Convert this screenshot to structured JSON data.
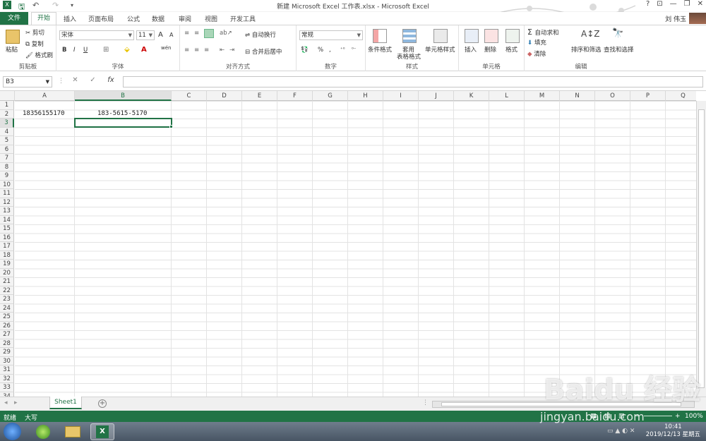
{
  "window": {
    "title": "新建 Microsoft Excel 工作表.xlsx - Microsoft Excel",
    "controls": [
      "?",
      "⊡",
      "—",
      "❐",
      "✕"
    ],
    "user_name": "刘 伟玉"
  },
  "tabs": [
    "文件",
    "开始",
    "插入",
    "页面布局",
    "公式",
    "数据",
    "审阅",
    "视图",
    "开发工具"
  ],
  "ribbon": {
    "clipboard": {
      "paste": "粘贴",
      "cut": "剪切",
      "copy": "复制",
      "format_painter": "格式刷",
      "label": "剪贴板"
    },
    "font": {
      "font_name": "宋体",
      "font_size": "11",
      "bold": "B",
      "italic": "I",
      "underline": "U",
      "label": "字体",
      "grow": "A",
      "shrink": "A",
      "font_color_glyph": "A",
      "wen": "wén"
    },
    "alignment": {
      "wrap_text": "自动换行",
      "merge_center": "合并后居中",
      "label": "对齐方式"
    },
    "number": {
      "format": "常规",
      "percent": "%",
      "comma": ",",
      "label": "数字"
    },
    "styles": {
      "conditional": "条件格式",
      "table_line1": "套用",
      "table_line2": "表格格式",
      "cell_styles": "单元格样式",
      "label": "样式"
    },
    "cells": {
      "insert": "插入",
      "delete": "删除",
      "format": "格式",
      "label": "单元格"
    },
    "editing": {
      "autosum": "自动求和",
      "fill": "填充",
      "clear": "清除",
      "sort_filter": "排序和筛选",
      "find_select": "查找和选择",
      "label": "编辑"
    }
  },
  "formula_bar": {
    "name_box": "B3",
    "cancel": "✕",
    "enter": "✓",
    "fx": "fx",
    "content": ""
  },
  "columns": [
    "A",
    "B",
    "C",
    "D",
    "E",
    "F",
    "G",
    "H",
    "I",
    "J",
    "K",
    "L",
    "M",
    "N",
    "O",
    "P",
    "Q"
  ],
  "rows": [
    "1",
    "2",
    "3",
    "4",
    "5",
    "6",
    "7",
    "8",
    "9",
    "10",
    "11",
    "12",
    "13",
    "14",
    "15",
    "16",
    "17",
    "18",
    "19",
    "20",
    "21",
    "22",
    "23",
    "24",
    "25",
    "26",
    "27",
    "28",
    "29",
    "30",
    "31",
    "32",
    "33",
    "34"
  ],
  "selected_cell": "B3",
  "cells": {
    "A2": "18356155170",
    "B2": "183-5615-5170"
  },
  "sheets": [
    "Sheet1"
  ],
  "add_sheet": "+",
  "status": {
    "ready": "就绪",
    "caps": "大写",
    "zoom": "100%"
  },
  "taskbar": {
    "time": "10:41",
    "date": "2019/12/13 星期五"
  },
  "watermark": {
    "brand": "Baidu 经验",
    "url": "jingyan.baidu.com"
  },
  "colors": {
    "excel_green": "#217346",
    "selection_green": "#217346"
  }
}
